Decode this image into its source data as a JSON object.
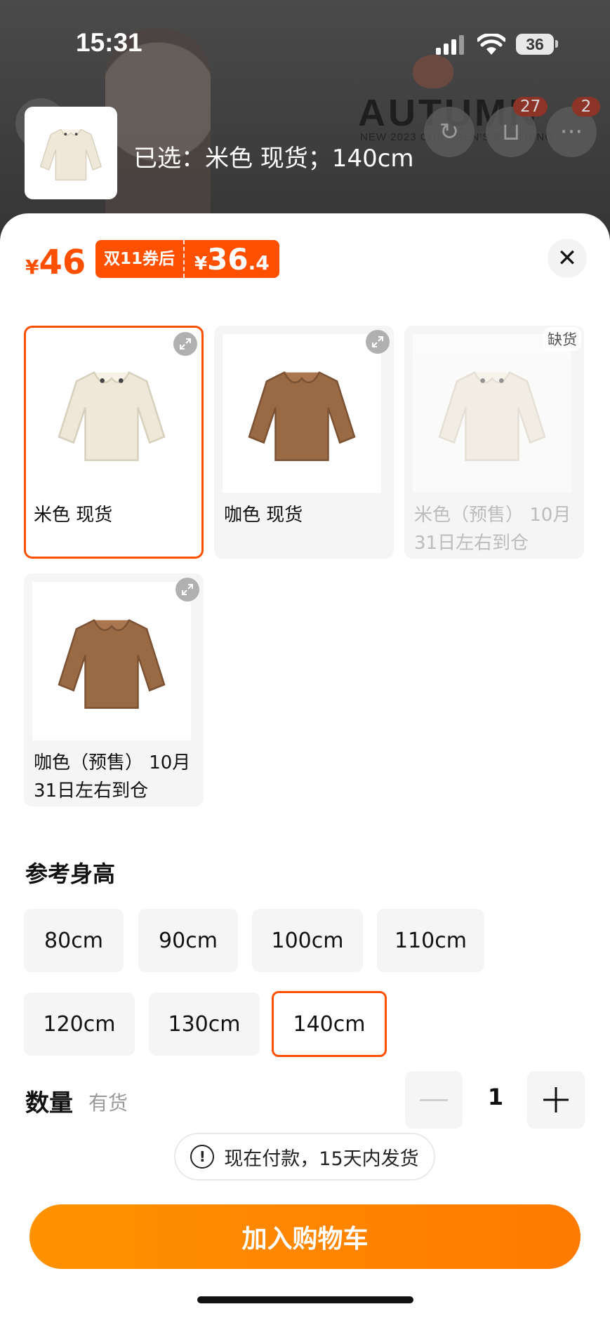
{
  "status_bar": {
    "time": "15:31",
    "battery": "36"
  },
  "background": {
    "brand_text": "AUTUMN",
    "brand_subtext": "NEW 2023 CHILDREN'S CLOTHING",
    "cart_badge": "27",
    "more_badge": "2"
  },
  "summary": {
    "text": "已选：米色 现货；140cm"
  },
  "price": {
    "currency": "¥",
    "current": "46",
    "coupon_label": "双11券后",
    "coupon_currency": "¥",
    "coupon_integer": "36",
    "coupon_decimal": ".4"
  },
  "variants": [
    {
      "label": "米色 现货",
      "color": "#efe8d8",
      "selected": true,
      "out_of_stock": false
    },
    {
      "label": "咖色 现货",
      "color": "#9a6a45",
      "selected": false,
      "out_of_stock": false
    },
    {
      "label": "米色（预售） 10月31日左右到仓",
      "color": "#efe8d8",
      "selected": false,
      "out_of_stock": true,
      "oos_label": "缺货"
    },
    {
      "label": "咖色（预售） 10月31日左右到仓",
      "color": "#9a6a45",
      "selected": false,
      "out_of_stock": false
    }
  ],
  "size_section": {
    "title": "参考身高",
    "options": [
      "80cm",
      "90cm",
      "100cm",
      "110cm",
      "120cm",
      "130cm",
      "140cm"
    ],
    "selected": "140cm"
  },
  "quantity": {
    "title": "数量",
    "stock": "有货",
    "value": "1",
    "minus": "—",
    "plus": "+"
  },
  "notice": {
    "icon_text": "!",
    "text": "现在付款，15天内发货"
  },
  "add_to_cart": {
    "label": "加入购物车"
  },
  "colors": {
    "accent": "#ff5000",
    "button": "#ff8a00"
  }
}
